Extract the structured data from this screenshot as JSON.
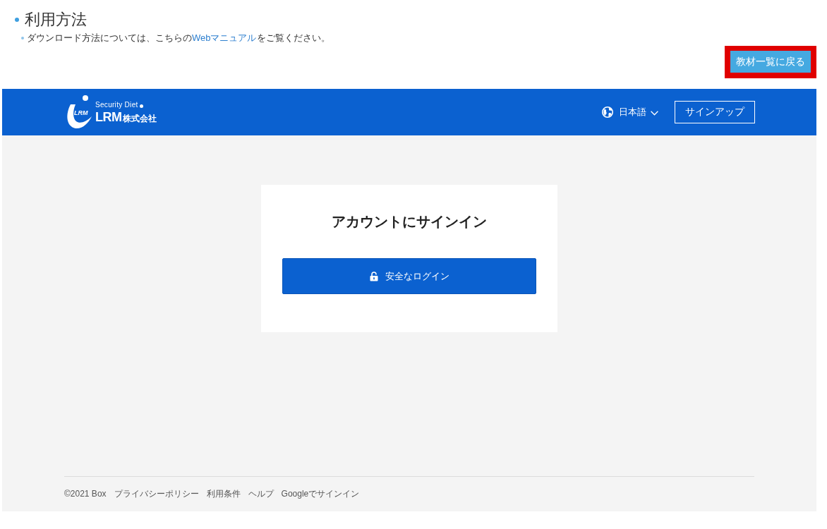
{
  "section": {
    "title": "利用方法",
    "note": {
      "before": "ダウンロード方法については、こちらの",
      "link": "Webマニュアル",
      "after": "をご覧ください。"
    }
  },
  "back_button": {
    "label": "教材一覧に戻る",
    "highlighted": true
  },
  "embedded_page": {
    "header": {
      "logo": {
        "emblem_text": "LRM",
        "tagline": "Security Diet",
        "brand": "LRM",
        "company_suffix": "株式会社"
      },
      "language": {
        "label": "日本語"
      },
      "signup_button": "サインアップ"
    },
    "signin_card": {
      "title": "アカウントにサインイン",
      "button": "安全なログイン"
    },
    "footer": {
      "copyright": "©2021 Box",
      "links": [
        "プライバシーポリシー",
        "利用条件",
        "ヘルプ",
        "Googleでサインイン"
      ]
    }
  }
}
